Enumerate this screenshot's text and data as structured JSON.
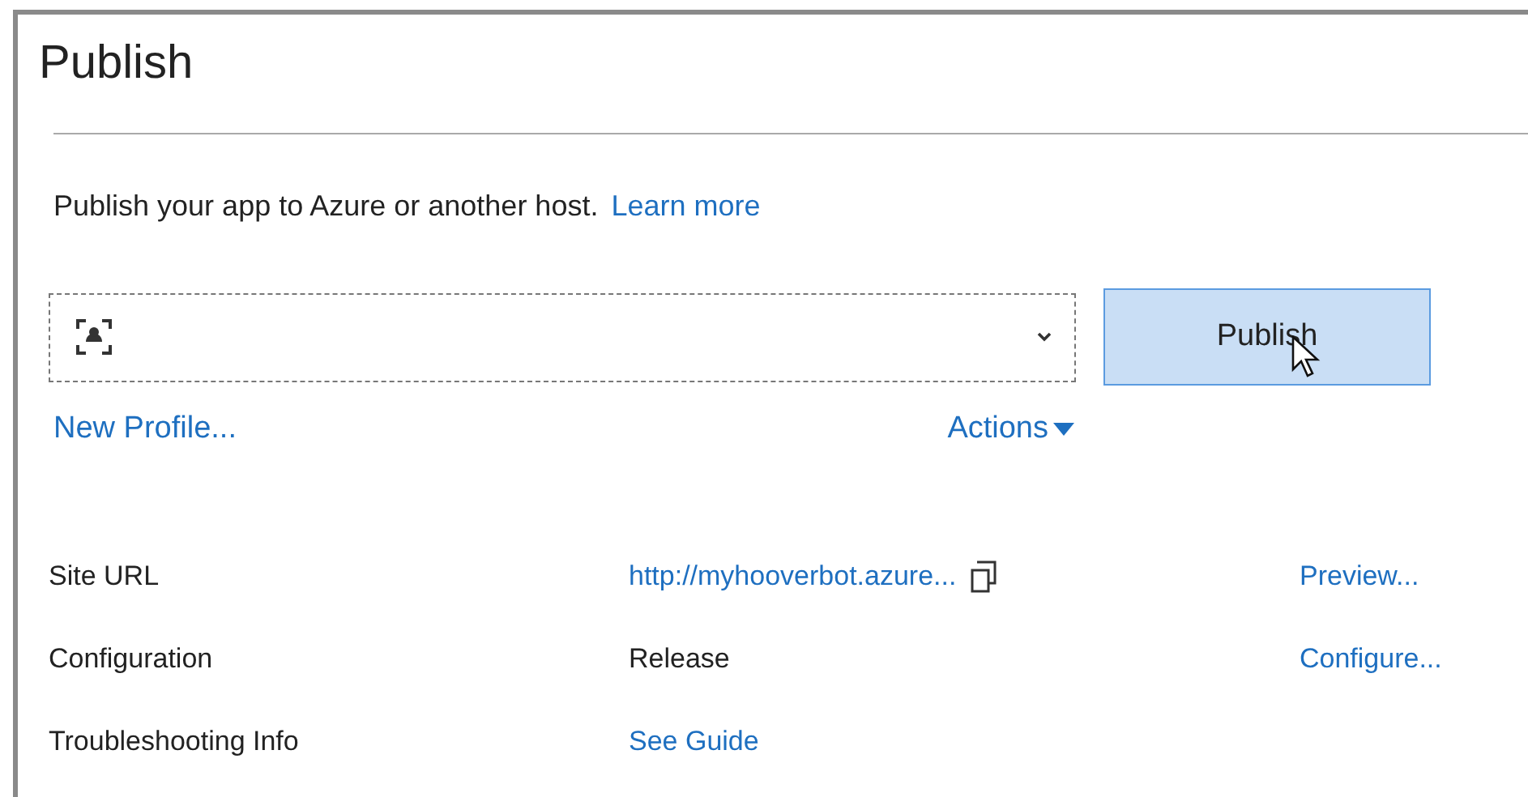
{
  "title": "Publish",
  "description": {
    "text": "Publish your app to Azure or another host.",
    "link": "Learn more"
  },
  "publish_button": {
    "label": "Publish"
  },
  "new_profile_link": "New Profile...",
  "actions_menu": {
    "label": "Actions"
  },
  "details": [
    {
      "label": "Site URL",
      "value": "http://myhooverbot.azure...",
      "kind": "link",
      "copyable": true,
      "action": "Preview..."
    },
    {
      "label": "Configuration",
      "value": "Release",
      "kind": "text",
      "copyable": false,
      "action": "Configure..."
    },
    {
      "label": "Troubleshooting Info",
      "value": "See Guide",
      "kind": "link",
      "copyable": false
    }
  ]
}
